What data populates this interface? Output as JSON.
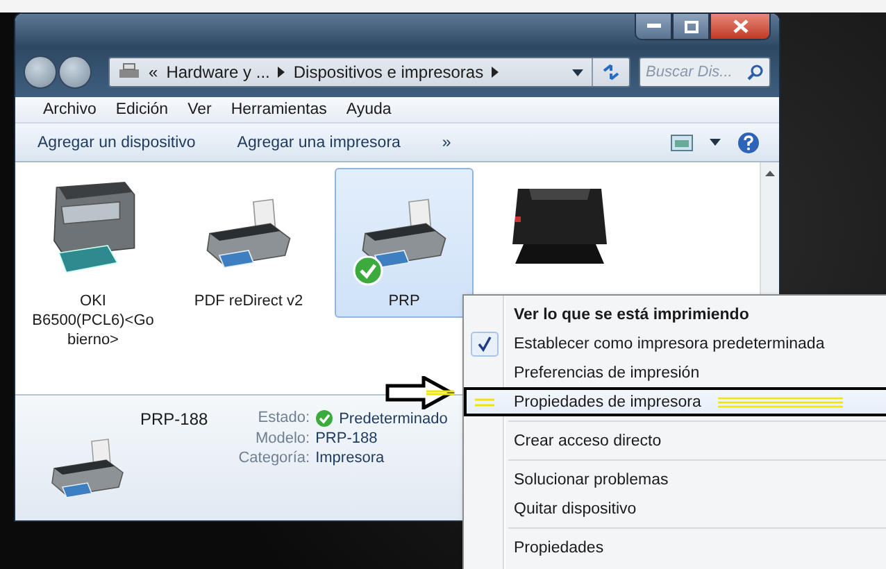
{
  "address": {
    "crumbs": [
      {
        "label": "«",
        "kind": "chevron"
      },
      {
        "label": "Hardware y ...",
        "kind": "crumb"
      },
      {
        "label": "Dispositivos e impresoras",
        "kind": "crumb"
      }
    ]
  },
  "search": {
    "placeholder": "Buscar Dis..."
  },
  "menu": [
    "Archivo",
    "Edición",
    "Ver",
    "Herramientas",
    "Ayuda"
  ],
  "toolbar": {
    "items": [
      "Agregar un dispositivo",
      "Agregar una impresora"
    ],
    "more": "»"
  },
  "devices": [
    {
      "lines": [
        "OKI",
        "B6500(PCL6)<Go",
        "bierno>"
      ],
      "kind": "multifunction",
      "selected": false,
      "default": false
    },
    {
      "lines": [
        "PDF reDirect v2"
      ],
      "kind": "inkjet",
      "selected": false,
      "default": false
    },
    {
      "lines": [
        "PRP"
      ],
      "kind": "inkjet",
      "selected": true,
      "default": true
    },
    {
      "kind": "laser",
      "selected": false,
      "default": false
    }
  ],
  "details": {
    "name": "PRP-188",
    "fields": [
      {
        "label": "Estado:",
        "value": "Predeterminado",
        "kind": "status"
      },
      {
        "label": "Modelo:",
        "value": "PRP-188",
        "kind": "text"
      },
      {
        "label": "Categoría:",
        "value": "Impresora",
        "kind": "text"
      }
    ]
  },
  "context_menu": [
    {
      "kind": "item",
      "label": "Ver lo que se está imprimiendo",
      "default": true,
      "checked": false,
      "highlighted": false
    },
    {
      "kind": "item",
      "label": "Establecer como impresora predeterminada",
      "default": false,
      "checked": true,
      "highlighted": false
    },
    {
      "kind": "item",
      "label": "Preferencias de impresión",
      "default": false,
      "checked": false,
      "highlighted": false
    },
    {
      "kind": "item",
      "label": "Propiedades de impresora",
      "default": false,
      "checked": false,
      "highlighted": true
    },
    {
      "kind": "separator"
    },
    {
      "kind": "item",
      "label": "Crear acceso directo",
      "default": false,
      "checked": false,
      "highlighted": false
    },
    {
      "kind": "separator"
    },
    {
      "kind": "item",
      "label": "Solucionar problemas",
      "default": false,
      "checked": false,
      "highlighted": false
    },
    {
      "kind": "item",
      "label": "Quitar dispositivo",
      "default": false,
      "checked": false,
      "highlighted": false
    },
    {
      "kind": "separator"
    },
    {
      "kind": "item",
      "label": "Propiedades",
      "default": false,
      "checked": false,
      "highlighted": false
    }
  ]
}
